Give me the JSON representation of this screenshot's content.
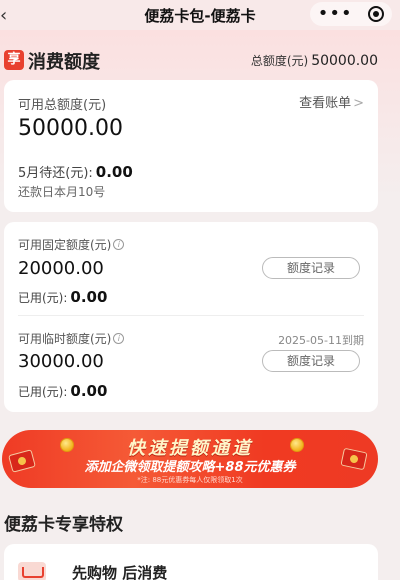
{
  "topbar": {
    "back_icon": "chevron-left-icon",
    "title": "便荔卡包-便荔卡",
    "more_icon": "more-dots-icon",
    "close_icon": "target-icon"
  },
  "section": {
    "badge": "享",
    "title": "消费额度",
    "total_label": "总额度(元)",
    "total_value": "50000.00"
  },
  "available": {
    "label": "可用总额度(元)",
    "value": "50000.00",
    "bill_link": "查看账单",
    "due_label": "5月待还(元):",
    "due_value": "0.00",
    "repay_day": "还款日本月10号"
  },
  "fixed": {
    "label": "可用固定额度(元)",
    "value": "20000.00",
    "record_button": "额度记录",
    "used_label": "已用(元):",
    "used_value": "0.00"
  },
  "temporary": {
    "label": "可用临时额度(元)",
    "expiry": "2025-05-11到期",
    "value": "30000.00",
    "record_button": "额度记录",
    "used_label": "已用(元):",
    "used_value": "0.00"
  },
  "banner": {
    "title": "快速提额通道",
    "subtitle": "添加企微领取提额攻略+88元优惠券",
    "note": "*注: 88元优惠券每人仅限领取1次"
  },
  "privileges": {
    "title": "便荔卡专享特权",
    "item_title": "先购物 后消费",
    "item_icon": "shopping-cart-icon"
  },
  "colors": {
    "brand_red": "#e8402f",
    "banner_red": "#ef3b25",
    "background": "#f4eeee"
  }
}
